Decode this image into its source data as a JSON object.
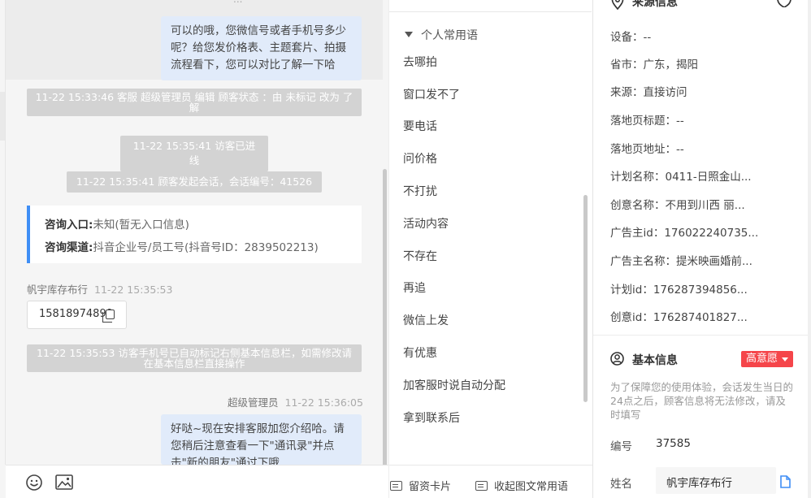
{
  "chat": {
    "clipped_header": "...",
    "msg1": "可以的哦，您微信号或者手机号多少呢？给您发价格表、主题套片、拍摄流程看下，您可以对比了解一下哈",
    "sys1": "11-22 15:33:46 客服 超级管理员 编辑 顾客状态 ：由 未标记 改为 了解",
    "sys2": "11-22 15:35:41 访客已进线",
    "sys3": "11-22 15:35:41 顾客发起会话，会话编号：41526",
    "card": {
      "entry_label": "咨询入口:",
      "entry_value": "未知(暂无入口信息)",
      "channel_label": "咨询渠道:",
      "channel_value": "抖音企业号/员工号(抖音号ID：2839502213)"
    },
    "visitor_name": "帆宇库存布行",
    "visitor_time": "11-22 15:35:53",
    "visitor_phone": "15818974899",
    "sys4": "11-22 15:35:53 访客手机号已自动标记右侧基本信息栏，如需修改请在基本信息栏直接操作",
    "agent_name": "超级管理员",
    "agent_time": "11-22 15:36:05",
    "msg2": "好哒~现在安排客服加您介绍哈。请您稍后注意查看一下\"通讯录\"并点击\"新的朋友\"通过下哦"
  },
  "phrases": {
    "header": "个人常用语",
    "items": [
      "去哪拍",
      "窗口发不了",
      "要电话",
      "问价格",
      "不打扰",
      "活动内容",
      "不存在",
      "再追",
      "微信上发",
      "有优惠",
      "加客服时说自动分配",
      "拿到联系后",
      "...."
    ],
    "card_btn": "留资卡片",
    "collapse_btn": "收起图文常用语"
  },
  "panel": {
    "source_title": "来源信息",
    "source_rows": [
      "设备：--",
      "省市：广东，揭阳",
      "来源：直接访问",
      "落地页标题：--",
      "落地页地址：--",
      "计划名称：0411-日照金山...",
      "创意名称：不用到川西 丽...",
      "广告主id：176022240735...",
      "广告主名称：提米映画婚前...",
      "计划id：176287394856...",
      "创意id：176287401827..."
    ],
    "basic_title": "基本信息",
    "intent_badge": "高意愿",
    "notice": "为了保障您的使用体验，会话发生当日的24点之后，顾客信息将无法修改，请及时填写",
    "id_label": "编号",
    "id_value": "37585",
    "name_label": "姓名",
    "name_value": "帆宇库存布行"
  }
}
